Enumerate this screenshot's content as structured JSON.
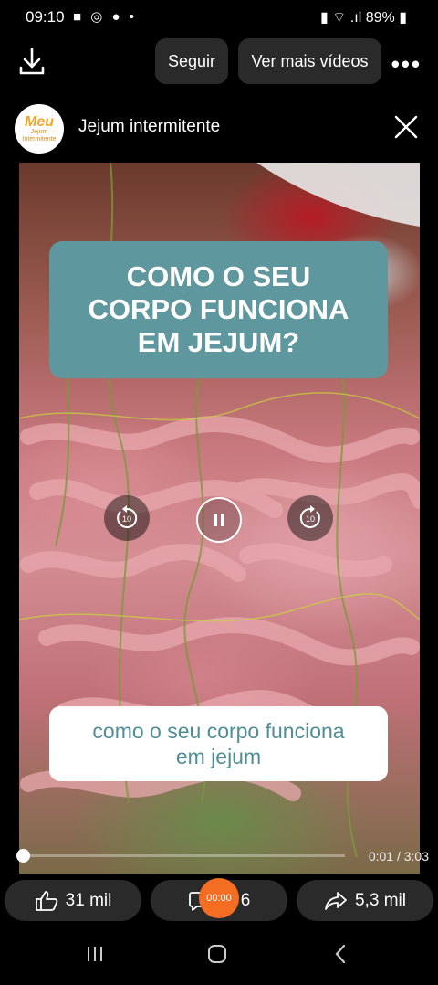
{
  "status_bar": {
    "time": "09:10",
    "battery": "89%",
    "left_icons": [
      "video-camera-icon",
      "whatsapp-icon",
      "chat-icon",
      "dot-icon"
    ],
    "right_icons": [
      "battery-saver-icon",
      "wifi-icon",
      "signal-icon",
      "battery-icon"
    ]
  },
  "top_bar": {
    "follow_label": "Seguir",
    "more_videos_label": "Ver mais vídeos",
    "more_icon": "ellipsis-icon",
    "download_icon": "download-icon"
  },
  "channel": {
    "avatar_text_1": "Meu",
    "avatar_text_2": "Jejum",
    "avatar_text_3": "Intermitente",
    "name": "Jejum intermitente",
    "close_icon": "close-icon"
  },
  "video": {
    "title_line1": "COMO O SEU",
    "title_line2": "CORPO FUNCIONA",
    "title_line3": "EM JEJUM?",
    "subtitle_line1": "como o seu corpo funciona",
    "subtitle_line2": "em jejum",
    "rewind_label": "10",
    "forward_label": "10",
    "progress_fraction": 0.005,
    "time_display": "0:01 / 3:03"
  },
  "actions": {
    "likes": "31 mil",
    "comments": "6",
    "shares": "5,3 mil",
    "recording_time": "00:00"
  },
  "colors": {
    "title_card": "#5f979e",
    "subtitle_text": "#4f8e94",
    "record_button": "#f36d22"
  }
}
